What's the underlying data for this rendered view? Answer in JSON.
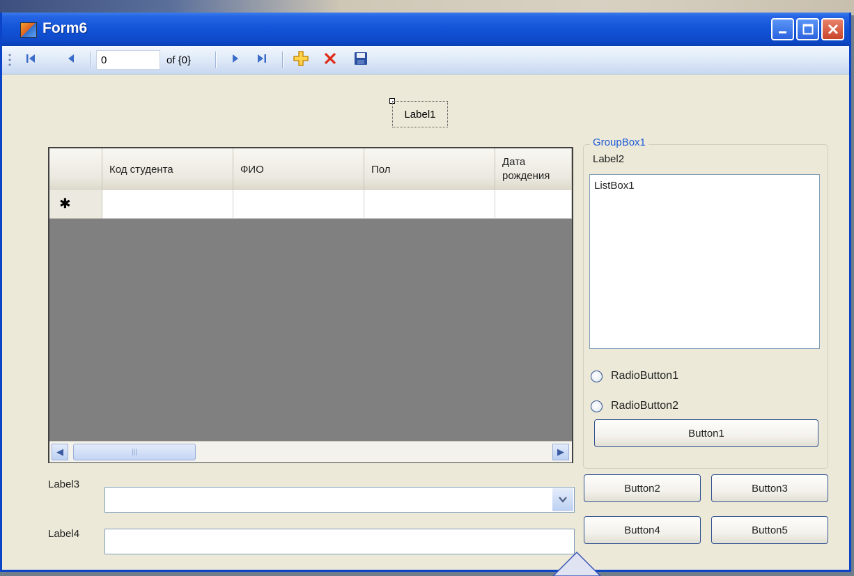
{
  "window": {
    "title": "Form6",
    "colors": {
      "titlebar": "#0e49c8",
      "client": "#ece9d8",
      "accent": "#1e5ad6"
    }
  },
  "title_buttons": {
    "minimize_icon": "minimize-icon",
    "maximize_icon": "maximize-icon",
    "close_icon": "close-icon"
  },
  "navigator": {
    "position_value": "0",
    "count_text": "of {0}",
    "icons": [
      "move-first-icon",
      "move-previous-icon",
      "move-next-icon",
      "move-last-icon",
      "add-new-icon",
      "delete-icon",
      "save-icon"
    ]
  },
  "label1": {
    "text": "Label1"
  },
  "grid": {
    "columns": [
      "Код студента",
      "ФИО",
      "Пол",
      "Дата рождения"
    ],
    "new_row_marker": "✱"
  },
  "groupbox": {
    "title": "GroupBox1",
    "label": "Label2",
    "listbox_text": "ListBox1",
    "radio1": "RadioButton1",
    "radio2": "RadioButton2",
    "button1": "Button1"
  },
  "bottom": {
    "label3": "Label3",
    "label4": "Label4",
    "combo_value": "",
    "textbox_value": "",
    "button2": "Button2",
    "button3": "Button3",
    "button4": "Button4",
    "button5": "Button5"
  }
}
